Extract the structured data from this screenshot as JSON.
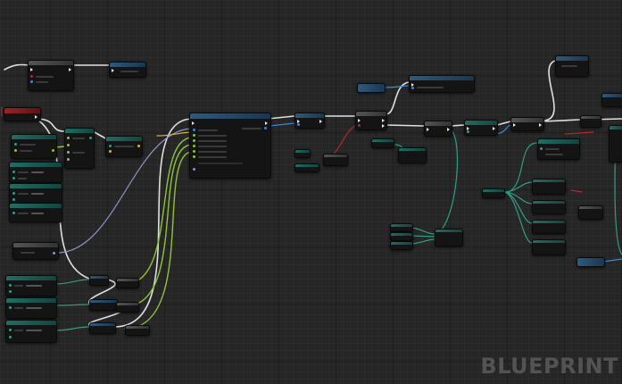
{
  "editor": {
    "type": "Blueprint Event Graph",
    "watermark": "BLUEPRINT",
    "zoom_level_visible": false,
    "colors": {
      "background": "#262626",
      "exec_wire": "#e8e8e8",
      "float_wire": "#8fc43a",
      "struct_wire": "#2f9e86",
      "object_wire": "#3a8ad6",
      "vector_wire": "#d4b43c",
      "bool_wire": "#b82727",
      "string_wire": "#8a93c9"
    },
    "node_header_colors": [
      "#2d5a7e",
      "#1f6e64",
      "#9a2424",
      "#555555",
      "#3b6e2d"
    ],
    "node_count_visible": 58
  }
}
